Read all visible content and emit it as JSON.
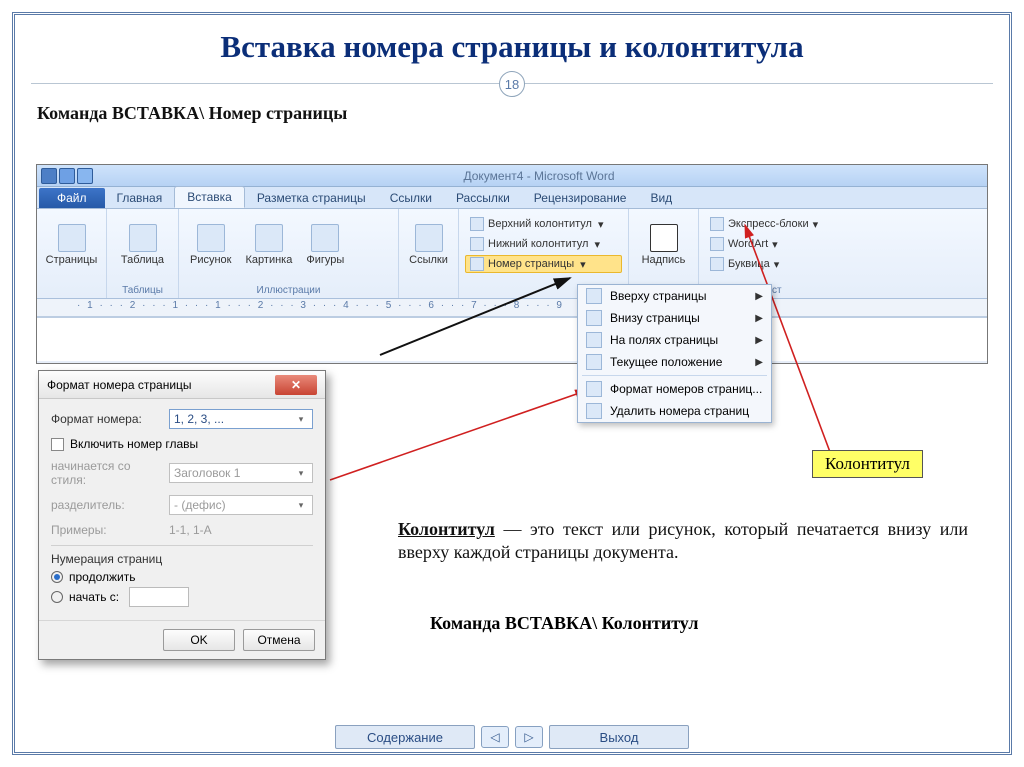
{
  "slide": {
    "title": "Вставка номера страницы и колонтитула",
    "page_number": "18",
    "subtitle": "Команда  ВСТАВКА\\ Номер страницы"
  },
  "word": {
    "doc_title": "Документ4 - Microsoft Word",
    "tabs": {
      "file": "Файл",
      "home": "Главная",
      "insert": "Вставка",
      "layout": "Разметка страницы",
      "refs": "Ссылки",
      "mail": "Рассылки",
      "review": "Рецензирование",
      "view": "Вид"
    },
    "ribbon": {
      "pages": "Страницы",
      "table": "Таблица",
      "tables_group": "Таблицы",
      "picture": "Рисунок",
      "clipart": "Картинка",
      "shapes": "Фигуры",
      "illustrations_group": "Иллюстрации",
      "links": "Ссылки",
      "header": "Верхний колонтитул",
      "footer": "Нижний колонтитул",
      "page_number": "Номер страницы",
      "textbox": "Надпись",
      "quickparts": "Экспресс-блоки",
      "wordart": "WordArt",
      "dropcap": "Буквица",
      "text_group": "Текст"
    },
    "menu": {
      "top": "Вверху страницы",
      "bottom": "Внизу страницы",
      "margins": "На полях страницы",
      "current": "Текущее положение",
      "format": "Формат номеров страниц...",
      "remove": "Удалить номера страниц"
    }
  },
  "dialog": {
    "title": "Формат номера страницы",
    "format_label": "Формат номера:",
    "format_value": "1, 2, 3, ...",
    "include_chapter": "Включить номер главы",
    "starts_with_style": "начинается со стиля:",
    "style_value": "Заголовок 1",
    "separator_label": "разделитель:",
    "separator_value": "-   (дефис)",
    "examples_label": "Примеры:",
    "examples_value": "1-1, 1-A",
    "numbering_group": "Нумерация страниц",
    "continue": "продолжить",
    "start_at": "начать с:",
    "ok": "OK",
    "cancel": "Отмена"
  },
  "callout": {
    "label": "Колонтитул"
  },
  "definition": {
    "term": "Колонтитул",
    "rest": " — это текст или рисунок, который печатается внизу или вверху каждой страницы документа."
  },
  "command2": "Команда  ВСТАВКА\\ Колонтитул",
  "nav": {
    "contents": "Содержание",
    "exit": "Выход"
  }
}
